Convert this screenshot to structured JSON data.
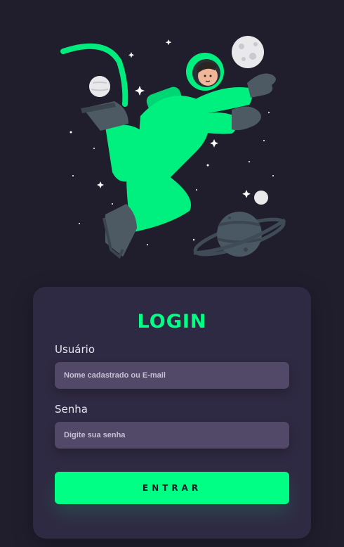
{
  "colors": {
    "background": "#201d2d",
    "card": "#2f2a43",
    "accent": "#00ff85",
    "input": "#524867"
  },
  "illustration": {
    "icon": "astronaut-floating-in-space-illustration"
  },
  "login": {
    "title": "LOGIN",
    "username_label": "Usuário",
    "username_placeholder": "Nome cadastrado ou E-mail",
    "password_label": "Senha",
    "password_placeholder": "Digite sua senha",
    "submit_label": "ENTRAR"
  }
}
